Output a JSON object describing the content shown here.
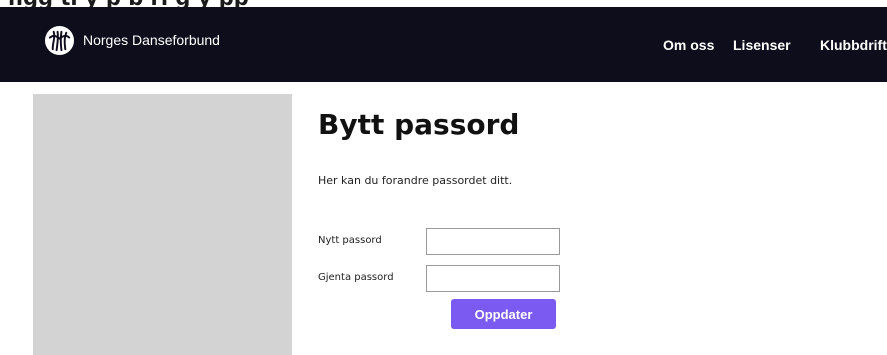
{
  "top_strip": {
    "clipped_text": "ngg  tl y  p   b   ri g   y  pp"
  },
  "header": {
    "brand_name": "Norges Danseforbund",
    "nav": [
      "Om oss",
      "Lisenser",
      "Klubbdrift"
    ]
  },
  "main": {
    "title": "Bytt passord",
    "intro": "Her kan du forandre passordet ditt.",
    "fields": [
      {
        "label": "Nytt passord",
        "value": ""
      },
      {
        "label": "Gjenta passord",
        "value": ""
      }
    ],
    "submit_label": "Oppdater"
  },
  "colors": {
    "header_bg": "#0d0d1c",
    "button_bg": "#7a5af0",
    "placeholder_bg": "#d3d3d3"
  },
  "icons": {
    "logo": "dancers-logo-icon"
  }
}
